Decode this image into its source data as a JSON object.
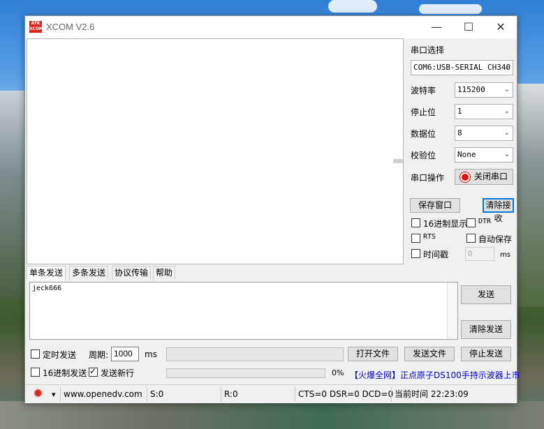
{
  "window": {
    "title": "XCOM V2.6",
    "logo_text": "ATK XCOM"
  },
  "controls": {
    "minimize": "—",
    "maximize": "☐",
    "close": "✕"
  },
  "settings": {
    "port_select_label": "串口选择",
    "port_value": "COM6:USB-SERIAL CH340",
    "baud_label": "波特率",
    "baud_value": "115200",
    "stop_label": "停止位",
    "stop_value": "1",
    "data_label": "数据位",
    "data_value": "8",
    "parity_label": "校验位",
    "parity_value": "None",
    "op_label": "串口操作",
    "op_button": "关闭串口",
    "save_window": "保存窗口",
    "clear_recv": "清除接收",
    "hex_display": "16进制显示",
    "dtr": "DTR",
    "rts": "RTS",
    "auto_save": "自动保存",
    "timestamp": "时间戳",
    "timestamp_value": "0",
    "timestamp_unit": "ms"
  },
  "tabs": [
    "单条发送",
    "多条发送",
    "协议传输",
    "帮助"
  ],
  "send": {
    "text": "jeck666",
    "send_button": "发送",
    "clear_send_button": "清除发送",
    "timed_send": "定时发送",
    "period_label": "周期:",
    "period_value": "1000",
    "period_unit": "ms",
    "hex_send": "16进制发送",
    "newline": "发送新行",
    "open_file": "打开文件",
    "send_file": "发送文件",
    "stop_send": "停止发送",
    "progress": "0%",
    "banner": "【火爆全网】正点原子DS100手持示波器上市"
  },
  "status": {
    "arrow": "▾",
    "url": "www.openedv.com",
    "sent": "S:0",
    "received": "R:0",
    "lines": "CTS=0 DSR=0 DCD=0",
    "time": "当前时间 22:23:09"
  },
  "colors": {
    "accent": "#0078d7",
    "led": "#e01010",
    "banner": "#0000cc",
    "gear": "#d7261e"
  }
}
